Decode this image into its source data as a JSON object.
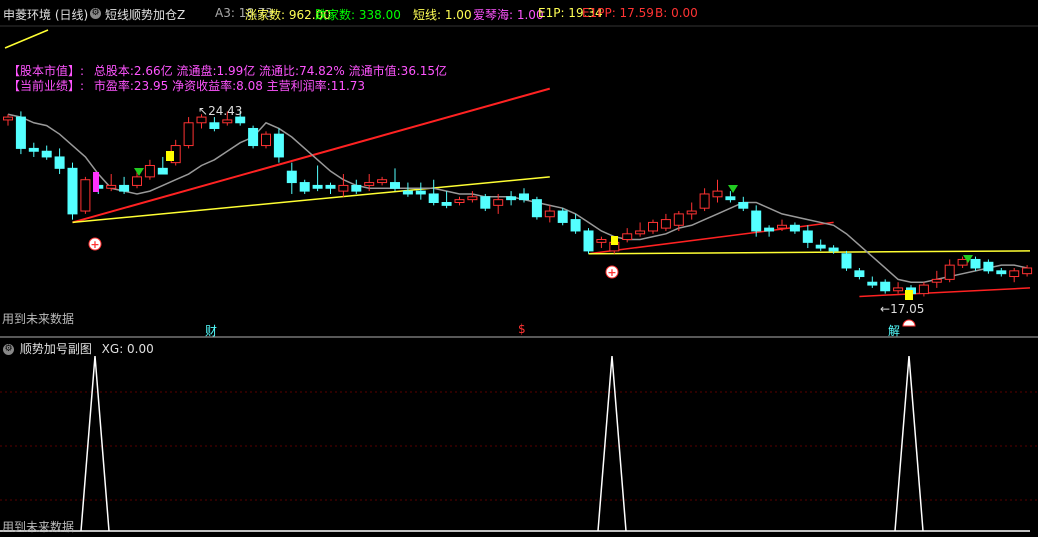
{
  "header": {
    "stock_title": "申菱环境 (日线)",
    "indicator_name": "短线顺势加仓Z",
    "values": [
      {
        "label": "A3: 18.73",
        "color": "#aaaaaa"
      },
      {
        "label": "涨家数: 962.00",
        "color": "#ffff55"
      },
      {
        "label": "跌家数: 338.00",
        "color": "#00ff00"
      },
      {
        "label": "短线: 1.00",
        "color": "#ffff55"
      },
      {
        "label": "爱琴海: 1.00",
        "color": "#ff55ff"
      },
      {
        "label": "E1P: 19.34",
        "color": "#ffff55"
      },
      {
        "label": "E1PP: 17.59",
        "color": "#ff3333"
      },
      {
        "label": "B: 0.00",
        "color": "#ff3333"
      }
    ]
  },
  "info": {
    "line1_tag": "【股本市值】:",
    "line1_text": "总股本:2.66亿 流通盘:1.99亿 流通比:74.82% 流通市值:36.15亿",
    "line2_tag": "【当前业绩】:",
    "line2_text": "市盈率:23.95 净资收益率:8.08 主营利润率:11.73"
  },
  "annotations": {
    "high_label": "24.43",
    "low_label": "17.05",
    "future_note_main": "用到未来数据",
    "future_note_sub": "用到未来数据",
    "event_cai": "财",
    "event_s": "$",
    "event_jie": "解"
  },
  "sub_panel": {
    "title": "顺势加号副图",
    "value": "XG: 0.00"
  },
  "colors": {
    "up": "#ff3333",
    "down": "#54ffff",
    "ma": "#999999",
    "trend_red": "#ff2222",
    "trend_yellow": "#ffff33"
  },
  "chart_data": {
    "type": "candlestick",
    "candles": [
      [
        19.5,
        19.7,
        19.3,
        19.6
      ],
      [
        19.6,
        19.8,
        18.3,
        18.5
      ],
      [
        18.5,
        18.7,
        18.2,
        18.4
      ],
      [
        18.4,
        18.6,
        18.1,
        18.2
      ],
      [
        18.2,
        18.5,
        17.6,
        17.8
      ],
      [
        17.8,
        18.0,
        16.0,
        16.2
      ],
      [
        16.3,
        17.5,
        16.2,
        17.4
      ],
      [
        17.2,
        17.5,
        16.9,
        17.1
      ],
      [
        17.1,
        17.6,
        17.0,
        17.2
      ],
      [
        17.2,
        17.5,
        16.9,
        17.0
      ],
      [
        17.2,
        17.7,
        17.1,
        17.5
      ],
      [
        17.5,
        18.1,
        17.4,
        17.9
      ],
      [
        17.8,
        18.2,
        17.6,
        17.6
      ],
      [
        18.0,
        18.8,
        17.9,
        18.6
      ],
      [
        18.6,
        19.6,
        18.5,
        19.4
      ],
      [
        19.4,
        19.7,
        19.2,
        19.6
      ],
      [
        19.4,
        19.6,
        19.1,
        19.2
      ],
      [
        19.4,
        19.8,
        19.3,
        19.5
      ],
      [
        19.6,
        19.8,
        19.3,
        19.4
      ],
      [
        19.2,
        19.3,
        18.5,
        18.6
      ],
      [
        18.6,
        19.1,
        18.5,
        19.0
      ],
      [
        19.0,
        19.2,
        18.0,
        18.2
      ],
      [
        17.7,
        18.0,
        16.9,
        17.3
      ],
      [
        17.3,
        17.4,
        16.9,
        17.0
      ],
      [
        17.2,
        17.9,
        17.0,
        17.1
      ],
      [
        17.2,
        17.3,
        16.9,
        17.1
      ],
      [
        17.0,
        17.6,
        16.8,
        17.2
      ],
      [
        17.2,
        17.4,
        16.9,
        17.0
      ],
      [
        17.2,
        17.6,
        17.0,
        17.3
      ],
      [
        17.3,
        17.5,
        17.2,
        17.4
      ],
      [
        17.3,
        17.8,
        17.0,
        17.1
      ],
      [
        17.0,
        17.3,
        16.8,
        16.9
      ],
      [
        17.0,
        17.3,
        16.7,
        16.9
      ],
      [
        16.9,
        17.4,
        16.5,
        16.6
      ],
      [
        16.6,
        17.0,
        16.4,
        16.5
      ],
      [
        16.6,
        16.8,
        16.5,
        16.7
      ],
      [
        16.7,
        17.0,
        16.6,
        16.8
      ],
      [
        16.8,
        16.9,
        16.3,
        16.4
      ],
      [
        16.5,
        16.9,
        16.2,
        16.7
      ],
      [
        16.8,
        17.0,
        16.5,
        16.7
      ],
      [
        16.9,
        17.1,
        16.6,
        16.7
      ],
      [
        16.7,
        16.8,
        16.0,
        16.1
      ],
      [
        16.1,
        16.5,
        15.9,
        16.3
      ],
      [
        16.3,
        16.4,
        15.8,
        15.9
      ],
      [
        16.0,
        16.2,
        15.5,
        15.6
      ],
      [
        15.6,
        15.7,
        14.8,
        14.9
      ],
      [
        15.2,
        15.4,
        15.0,
        15.3
      ],
      [
        14.9,
        15.4,
        14.8,
        15.2
      ],
      [
        15.3,
        15.7,
        15.2,
        15.5
      ],
      [
        15.5,
        15.9,
        15.4,
        15.6
      ],
      [
        15.6,
        16.0,
        15.5,
        15.9
      ],
      [
        15.7,
        16.2,
        15.6,
        16.0
      ],
      [
        15.8,
        16.3,
        15.6,
        16.2
      ],
      [
        16.2,
        16.6,
        16.0,
        16.3
      ],
      [
        16.4,
        17.1,
        16.3,
        16.9
      ],
      [
        16.8,
        17.4,
        16.6,
        17.0
      ],
      [
        16.8,
        17.0,
        16.6,
        16.7
      ],
      [
        16.6,
        16.8,
        16.3,
        16.4
      ],
      [
        16.3,
        16.5,
        15.4,
        15.6
      ],
      [
        15.7,
        15.8,
        15.4,
        15.6
      ],
      [
        15.7,
        16.0,
        15.6,
        15.8
      ],
      [
        15.8,
        15.9,
        15.5,
        15.6
      ],
      [
        15.6,
        15.8,
        15.0,
        15.2
      ],
      [
        15.1,
        15.3,
        14.9,
        15.0
      ],
      [
        15.0,
        15.1,
        14.8,
        14.9
      ],
      [
        14.8,
        14.9,
        14.2,
        14.3
      ],
      [
        14.2,
        14.3,
        13.9,
        14.0
      ],
      [
        13.8,
        14.0,
        13.6,
        13.7
      ],
      [
        13.8,
        13.9,
        13.4,
        13.5
      ],
      [
        13.5,
        13.8,
        13.4,
        13.6
      ],
      [
        13.6,
        13.7,
        13.3,
        13.4
      ],
      [
        13.4,
        13.8,
        13.3,
        13.7
      ],
      [
        13.8,
        14.2,
        13.6,
        13.9
      ],
      [
        13.9,
        14.6,
        13.8,
        14.4
      ],
      [
        14.4,
        14.7,
        14.3,
        14.6
      ],
      [
        14.6,
        14.7,
        14.2,
        14.3
      ],
      [
        14.5,
        14.6,
        14.1,
        14.2
      ],
      [
        14.2,
        14.3,
        14.0,
        14.1
      ],
      [
        14.0,
        14.3,
        13.8,
        14.2
      ],
      [
        14.1,
        14.4,
        14.0,
        14.3
      ]
    ],
    "ma_line": [
      19.7,
      19.6,
      19.4,
      19.3,
      19.0,
      18.6,
      18.2,
      17.6,
      17.1,
      17.0,
      16.9,
      17.0,
      17.2,
      17.4,
      17.6,
      17.9,
      18.1,
      18.4,
      18.7,
      18.9,
      19.4,
      19.2,
      18.9,
      18.5,
      18.1,
      17.7,
      17.4,
      17.2,
      17.1,
      17.1,
      17.1,
      17.1,
      17.1,
      17.1,
      17.0,
      16.9,
      16.9,
      16.8,
      16.8,
      16.8,
      16.7,
      16.6,
      16.5,
      16.4,
      16.2,
      15.9,
      15.6,
      15.4,
      15.3,
      15.3,
      15.4,
      15.5,
      15.7,
      15.8,
      16.0,
      16.2,
      16.4,
      16.6,
      16.6,
      16.4,
      16.2,
      16.1,
      16.0,
      15.9,
      15.8,
      15.5,
      15.1,
      14.7,
      14.3,
      13.9,
      13.8,
      13.8,
      13.9,
      14.0,
      14.1,
      14.2,
      14.3,
      14.4,
      14.4,
      14.3
    ],
    "signals_xg": [
      5,
      38,
      63
    ]
  }
}
